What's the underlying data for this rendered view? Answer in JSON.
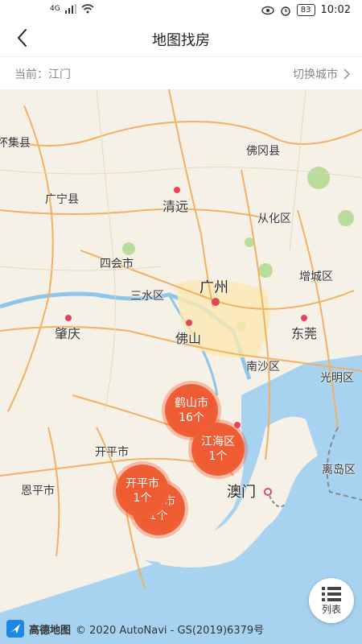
{
  "status": {
    "network": "4G",
    "battery": "83",
    "time": "10:02"
  },
  "header": {
    "title": "地图找房",
    "back_icon": "back-arrow-icon"
  },
  "city_bar": {
    "current": "当前：江门",
    "switch_label": "切换城市"
  },
  "map_labels": [
    {
      "text": "怀集县"
    },
    {
      "text": "佛冈县"
    },
    {
      "text": "广宁县"
    },
    {
      "text": "清远"
    },
    {
      "text": "从化区"
    },
    {
      "text": "四会市"
    },
    {
      "text": "增城区"
    },
    {
      "text": "三水区"
    },
    {
      "text": "广州"
    },
    {
      "text": "肇庆"
    },
    {
      "text": "佛山"
    },
    {
      "text": "东莞"
    },
    {
      "text": "南沙区"
    },
    {
      "text": "光明区"
    },
    {
      "text": "开平市"
    },
    {
      "text": "恩平市"
    },
    {
      "text": "澳门"
    },
    {
      "text": "离岛区"
    }
  ],
  "clusters": [
    {
      "name": "鹤山市",
      "count": "16个"
    },
    {
      "name": "江海区",
      "count": "1个"
    },
    {
      "name": "开平市",
      "count": "1个"
    },
    {
      "name": "台山市",
      "count": "1个"
    }
  ],
  "list_button": {
    "label": "列表"
  },
  "footer": {
    "logo_text": "高德地图",
    "copyright": "© 2020 AutoNavi - GS(2019)6379号"
  }
}
